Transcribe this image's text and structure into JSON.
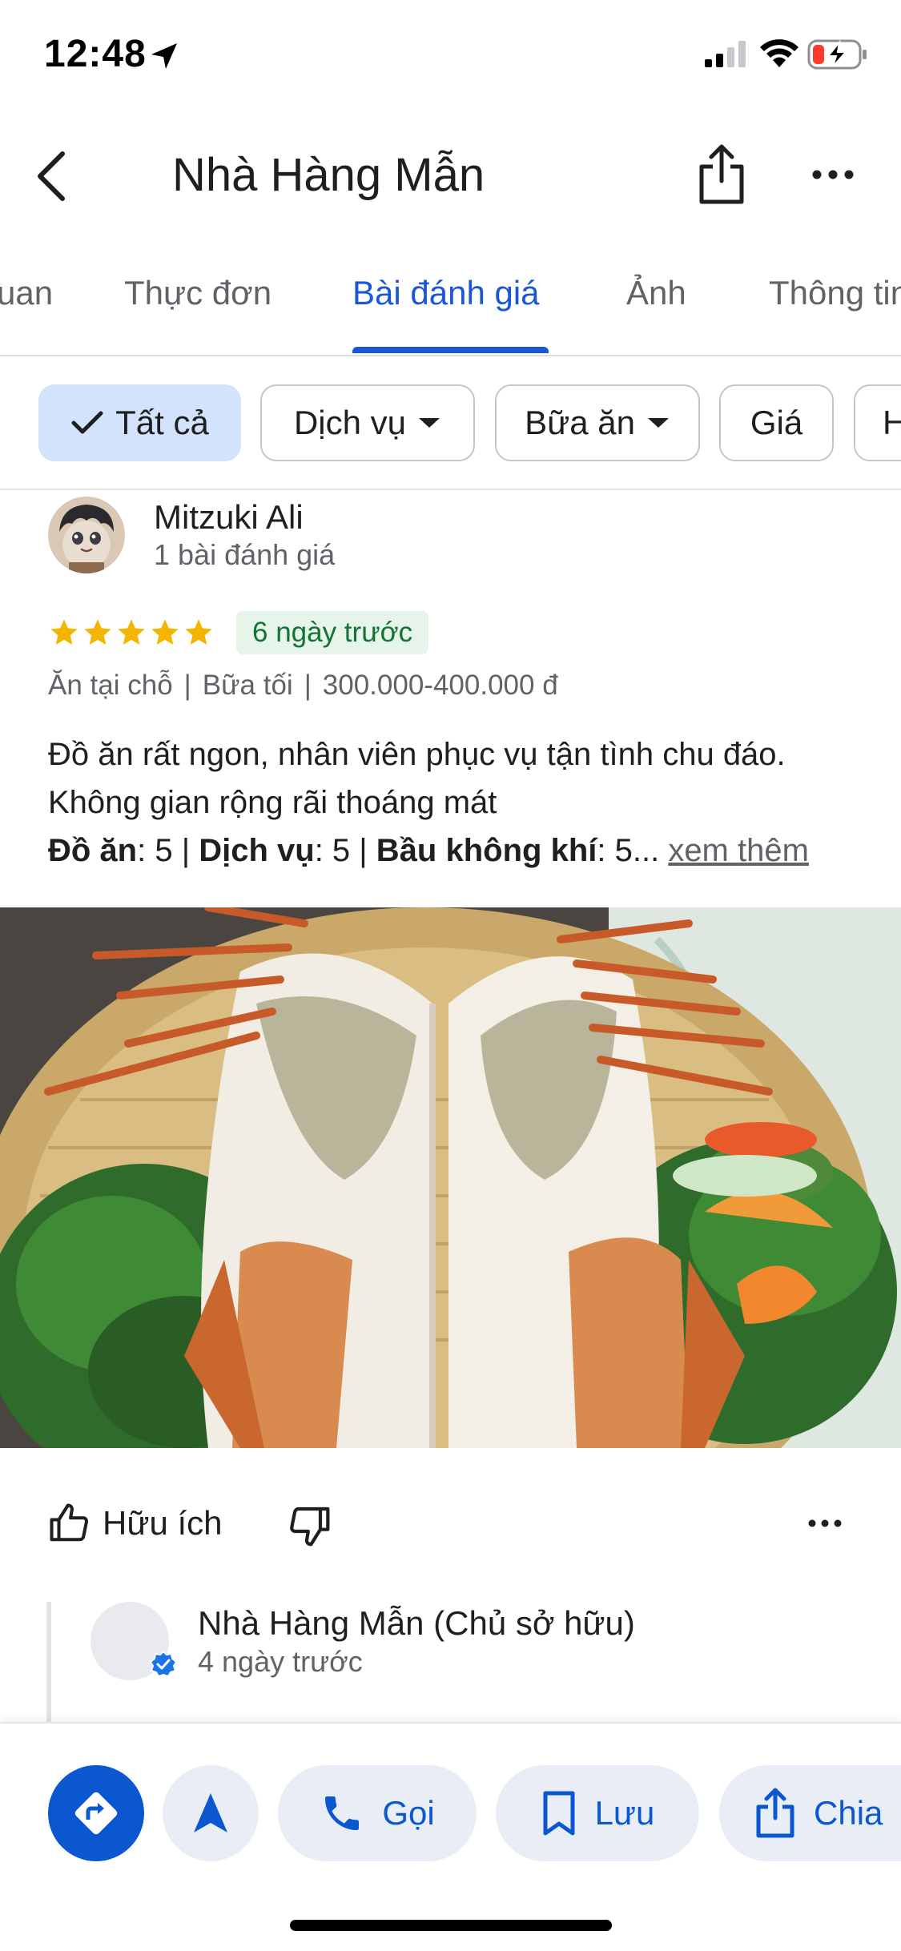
{
  "status_bar": {
    "time": "12:48"
  },
  "header": {
    "title": "Nhà Hàng Mẫn"
  },
  "tabs": [
    {
      "label": "uan"
    },
    {
      "label": "Thực đơn"
    },
    {
      "label": "Bài đánh giá"
    },
    {
      "label": "Ảnh"
    },
    {
      "label": "Thông tin"
    }
  ],
  "filters": [
    {
      "label": "Tất cả",
      "selected": true
    },
    {
      "label": "Dịch vụ"
    },
    {
      "label": "Bữa ăn"
    },
    {
      "label": "Giá"
    },
    {
      "label": "H"
    }
  ],
  "review": {
    "author": "Mitzuki Ali",
    "author_meta": "1 bài đánh giá",
    "rating": 5,
    "date": "6 ngày trước",
    "meta": [
      "Ăn tại chỗ",
      "|",
      "Bữa tối",
      "|",
      "300.000-400.000 đ"
    ],
    "text": "Đồ ăn rất ngon, nhân viên phục vụ tận tình chu đáo. Không gian rộng rãi thoáng mát",
    "scores": {
      "food_label": "Đồ ăn",
      "food_value": ": 5 | ",
      "service_label": "Dịch vụ",
      "service_value": ": 5 | ",
      "atmosphere_label": "Bầu không khí",
      "atmosphere_value": ": 5...",
      "see_more": "xem thêm"
    },
    "helpful_label": "Hữu ích"
  },
  "owner_reply": {
    "name": "Nhà Hàng Mẫn (Chủ sở hữu)",
    "date": "4 ngày trước"
  },
  "bottom_bar": {
    "call": "Gọi",
    "save": "Lưu",
    "share": "Chia"
  },
  "colors": {
    "accent": "#1a57d8",
    "chip_selected": "#d3e3fd",
    "star": "#f4b400",
    "date_badge_bg": "#e6f4ea",
    "date_badge_text": "#137333"
  }
}
